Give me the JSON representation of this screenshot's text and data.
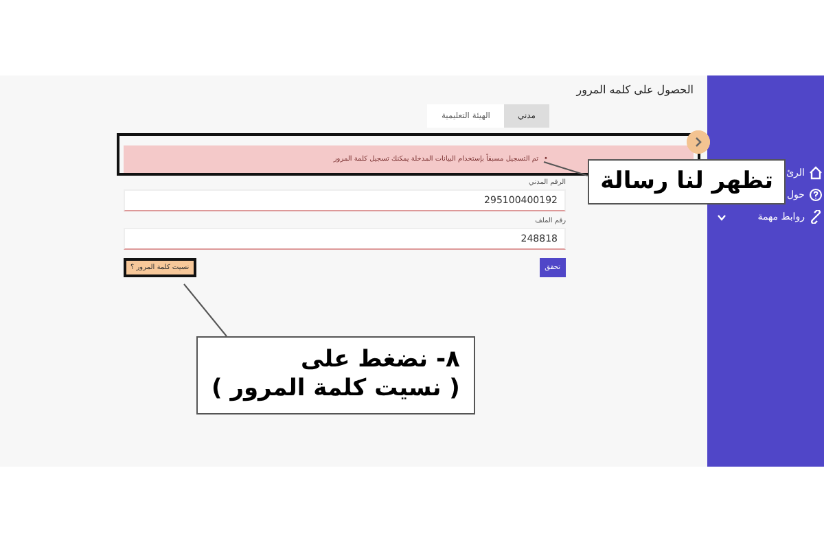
{
  "page": {
    "title": "الحصول على كلمه المرور"
  },
  "tabs": [
    {
      "label": "مدني",
      "selected": true
    },
    {
      "label": "الهيئة التعليمية",
      "selected": false
    }
  ],
  "alert": {
    "bullet": "•",
    "text": "تم التسجيل مسبقاً بإستخدام البيانات المدخلة يمكنك تسجيل كلمة المرور"
  },
  "fields": [
    {
      "label": "الرقم المدني",
      "value": "295100400192"
    },
    {
      "label": "رقم الملف",
      "value": "248818"
    }
  ],
  "submit_button": "تحقق",
  "forgot_link": "نسيت كلمة المرور ؟",
  "sidebar": {
    "items": [
      {
        "label": "الرئ",
        "expandable": false
      },
      {
        "label": "حول",
        "expandable": false
      },
      {
        "label": "روابط مهمة",
        "expandable": true
      }
    ]
  },
  "callouts": [
    {
      "lines": [
        "تظهر لنا رسالة"
      ]
    },
    {
      "lines": [
        "٨- نضغط على",
        "( نسيت كلمة المرور )"
      ]
    }
  ]
}
